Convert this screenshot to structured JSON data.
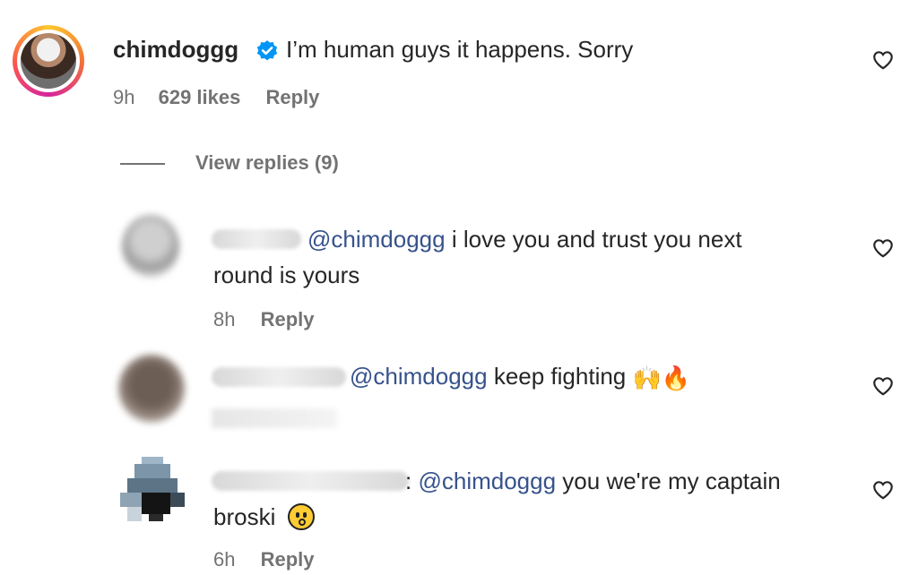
{
  "main_comment": {
    "username": "chimdoggg",
    "text": "I’m human guys it happens. Sorry",
    "time": "9h",
    "likes": "629 likes",
    "reply_label": "Reply",
    "verified": true
  },
  "view_replies": "View replies (9)",
  "replies": [
    {
      "mention": "@chimdoggg",
      "text": "i love you and trust you next",
      "text2": "round is yours",
      "time": "8h",
      "reply_label": "Reply"
    },
    {
      "mention": "@chimdoggg",
      "text": "keep fighting",
      "emoji": "🙌🔥",
      "time": "",
      "reply_label": ""
    },
    {
      "mention": "@chimdoggg",
      "text": "you we're my captain",
      "text2": "broski",
      "time": "6h",
      "reply_label": "Reply"
    }
  ],
  "colors": {
    "mention": "#37528c",
    "meta": "#737373",
    "text": "#262626"
  },
  "icons": [
    "heart-icon",
    "verified-badge-icon"
  ]
}
